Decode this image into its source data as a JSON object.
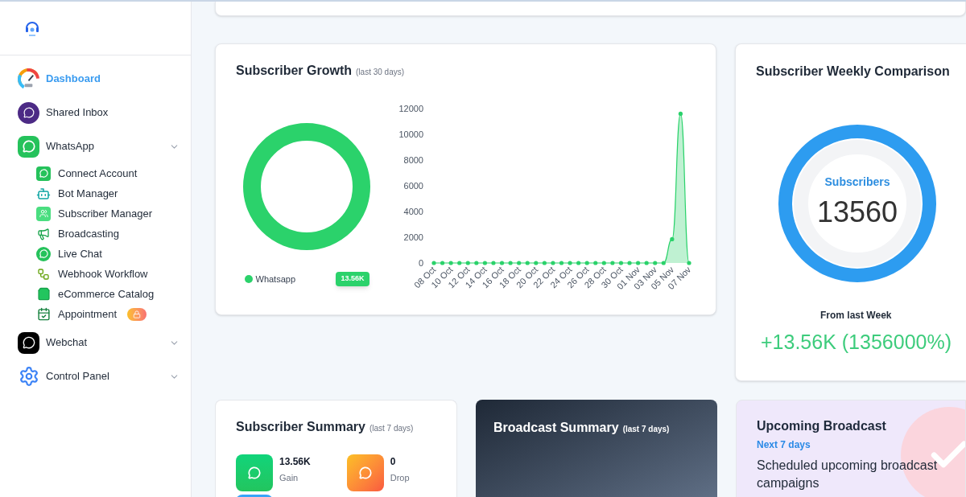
{
  "sidebar": {
    "items": [
      {
        "label": "Dashboard",
        "selected": true
      },
      {
        "label": "Shared Inbox",
        "selected": false
      },
      {
        "label": "WhatsApp",
        "selected": false,
        "children": [
          {
            "label": "Connect Account",
            "locked": false
          },
          {
            "label": "Bot Manager",
            "locked": false
          },
          {
            "label": "Subscriber Manager",
            "locked": false
          },
          {
            "label": "Broadcasting",
            "locked": false
          },
          {
            "label": "Live Chat",
            "locked": false
          },
          {
            "label": "Webhook Workflow",
            "locked": false
          },
          {
            "label": "eCommerce Catalog",
            "locked": false
          },
          {
            "label": "Appointment",
            "locked": true
          }
        ]
      },
      {
        "label": "Webchat",
        "selected": false
      },
      {
        "label": "Control Panel",
        "selected": false
      }
    ]
  },
  "growth": {
    "title": "Subscriber Growth",
    "subtitle": "(last 30 days)",
    "donut": {
      "legend": "Whatsapp",
      "badge": "13.56K"
    },
    "line": {
      "chart_data": {
        "type": "area",
        "categories": [
          "08 Oct",
          null,
          "10 Oct",
          null,
          "12 Oct",
          null,
          "14 Oct",
          null,
          "16 Oct",
          null,
          "18 Oct",
          null,
          "20 Oct",
          null,
          "22 Oct",
          null,
          "24 Oct",
          null,
          "26 Oct",
          null,
          "28 Oct",
          null,
          "30 Oct",
          null,
          "01 Nov",
          null,
          "03 Nov",
          null,
          "05 Nov",
          null,
          "07 Nov"
        ],
        "series": [
          {
            "color": "#2bd26b",
            "values": [
              0,
              0,
              0,
              0,
              0,
              0,
              0,
              0,
              0,
              0,
              0,
              0,
              0,
              0,
              0,
              0,
              0,
              0,
              0,
              0,
              0,
              0,
              0,
              0,
              0,
              0,
              0,
              0,
              1850,
              11600,
              0
            ]
          }
        ],
        "ylim": [
          0,
          12000
        ],
        "yticks": [
          0,
          2000,
          4000,
          6000,
          8000,
          10000,
          12000
        ]
      }
    }
  },
  "weekly": {
    "title": "Subscriber Weekly Comparison",
    "ring_label": "Subscribers",
    "ring_value": "13560",
    "from_label": "From last Week",
    "change": "+13.56K (1356000%)"
  },
  "summary": {
    "title": "Subscriber Summary",
    "subtitle": "(last 7 days)",
    "stats": [
      {
        "value": "13.56K",
        "label": "Gain",
        "kind": "gain"
      },
      {
        "value": "0",
        "label": "Drop",
        "kind": "drop"
      }
    ]
  },
  "broadcast": {
    "title": "Broadcast Summary",
    "subtitle": "(last 7 days)"
  },
  "upcoming": {
    "title": "Upcoming Broadcast",
    "subtitle": "Next 7 days",
    "text": "Scheduled upcoming broadcast campaigns"
  }
}
